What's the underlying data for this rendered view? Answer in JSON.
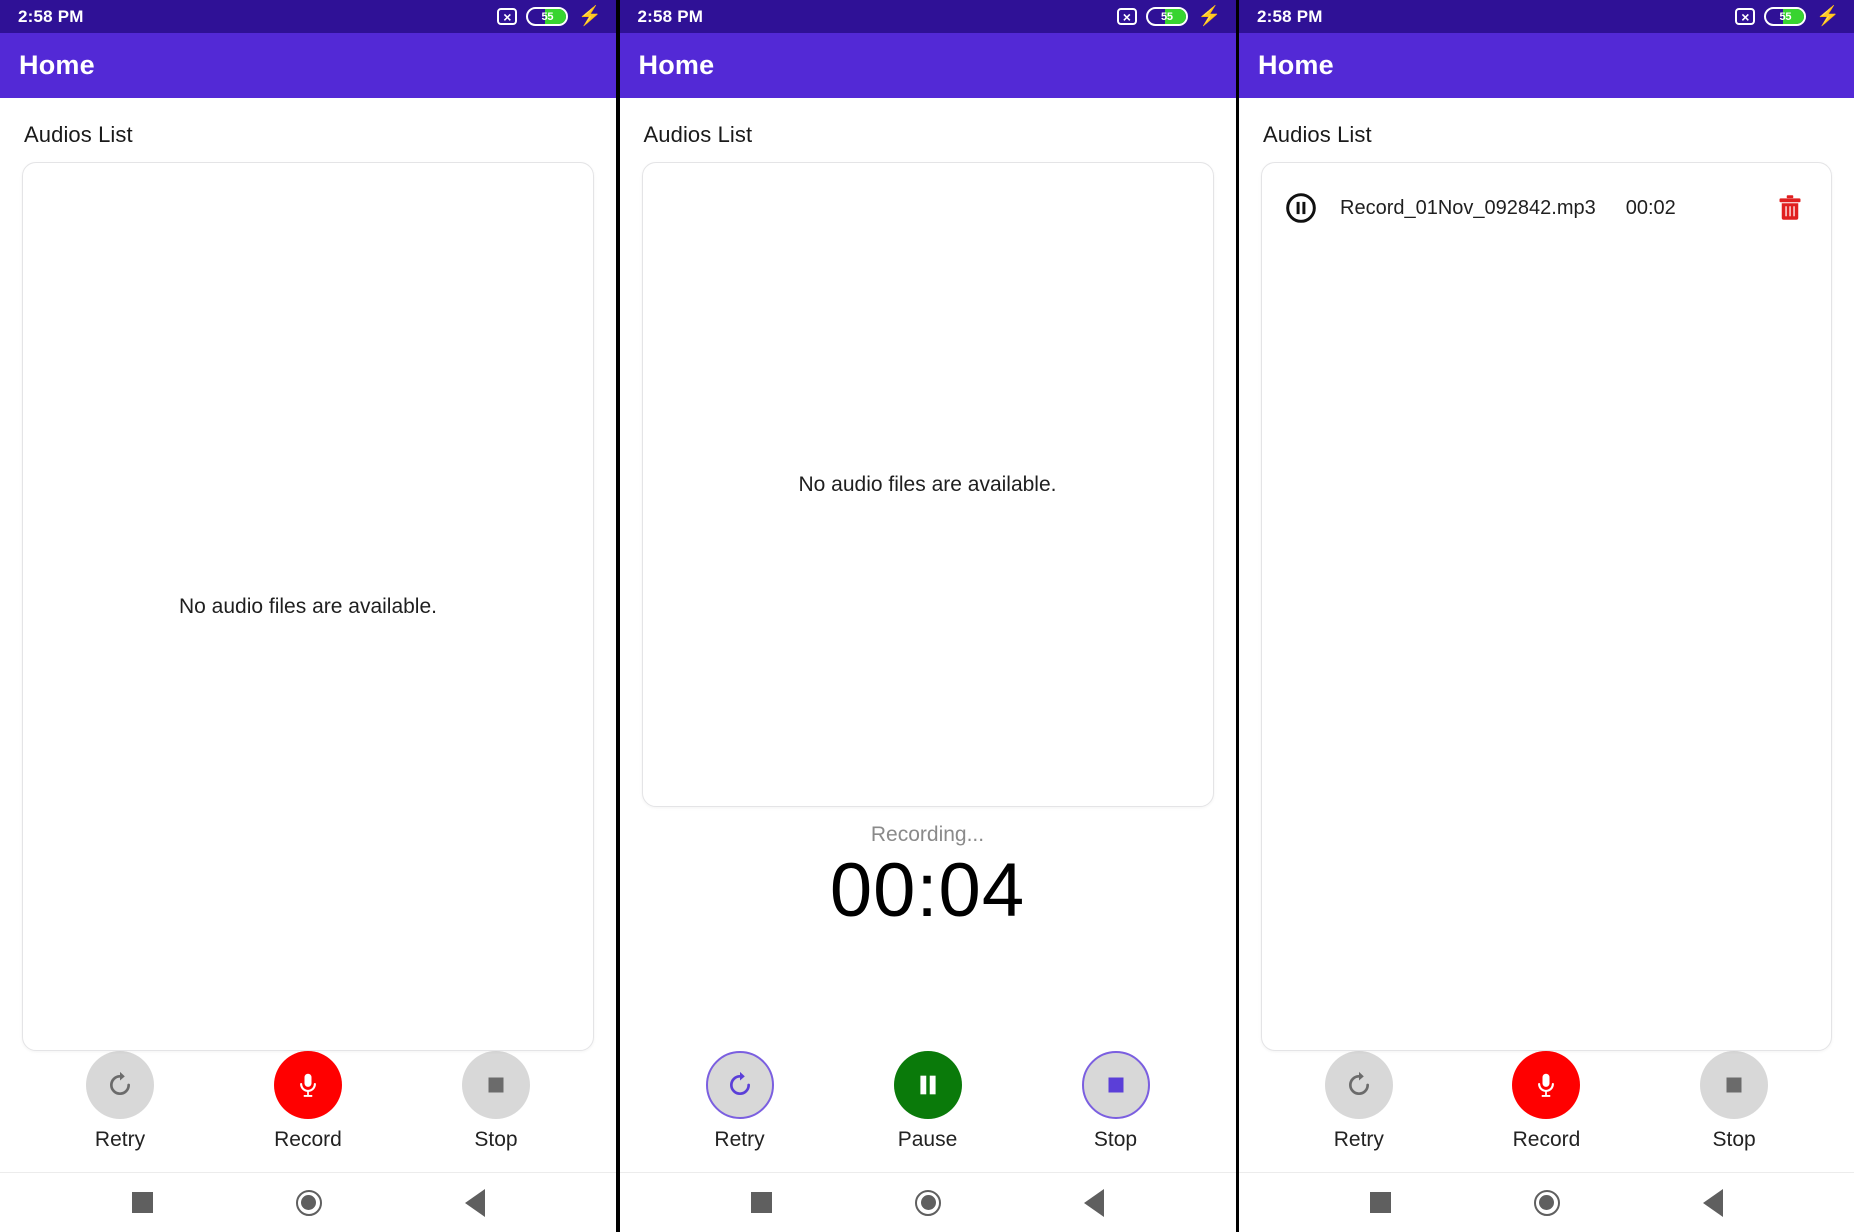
{
  "colors": {
    "status_bar": "#2F1196",
    "app_bar": "#5329D6",
    "accent_purple": "#7B5FE0",
    "record_red": "#FF0000",
    "pause_green": "#0A7A0A",
    "delete_red": "#E53935",
    "idle_gray": "#D8D8D8",
    "battery_green": "#38D430"
  },
  "status_bar": {
    "time": "2:58 PM",
    "sim_icon": "sim-card-disabled-icon",
    "battery_level": "55",
    "charging_icon": "lightning-bolt-icon"
  },
  "app_bar": {
    "title": "Home"
  },
  "section": {
    "title": "Audios List"
  },
  "empty_state": {
    "message": "No audio files are available."
  },
  "nav_bar": {
    "recents": "recents-square-icon",
    "home": "home-circle-icon",
    "back": "back-triangle-icon"
  },
  "panels": [
    {
      "id": "panel-idle",
      "state": "idle",
      "card": {
        "empty": true,
        "empty_message": "No audio files are available."
      },
      "timer": null,
      "controls": [
        {
          "name": "retry",
          "label": "Retry",
          "icon": "refresh-icon",
          "style": "gray",
          "enabled": false
        },
        {
          "name": "record",
          "label": "Record",
          "icon": "microphone-icon",
          "style": "red",
          "enabled": true
        },
        {
          "name": "stop",
          "label": "Stop",
          "icon": "stop-square-icon",
          "style": "gray",
          "enabled": false
        }
      ]
    },
    {
      "id": "panel-recording",
      "state": "recording",
      "card": {
        "empty": true,
        "empty_message": "No audio files are available."
      },
      "timer": {
        "status_label": "Recording...",
        "elapsed": "00:04"
      },
      "controls": [
        {
          "name": "retry",
          "label": "Retry",
          "icon": "refresh-icon",
          "style": "gray-purple-border",
          "enabled": true
        },
        {
          "name": "pause",
          "label": "Pause",
          "icon": "pause-icon",
          "style": "green",
          "enabled": true
        },
        {
          "name": "stop",
          "label": "Stop",
          "icon": "stop-square-icon",
          "style": "gray-purple-border",
          "enabled": true
        }
      ]
    },
    {
      "id": "panel-saved",
      "state": "saved",
      "card": {
        "empty": false,
        "items": [
          {
            "play_icon": "pause-circle-icon",
            "file_name": "Record_01Nov_092842.mp3",
            "duration": "00:02",
            "delete_icon": "trash-icon"
          }
        ]
      },
      "timer": null,
      "controls": [
        {
          "name": "retry",
          "label": "Retry",
          "icon": "refresh-icon",
          "style": "gray",
          "enabled": false
        },
        {
          "name": "record",
          "label": "Record",
          "icon": "microphone-icon",
          "style": "red",
          "enabled": true
        },
        {
          "name": "stop",
          "label": "Stop",
          "icon": "stop-square-icon",
          "style": "gray",
          "enabled": false
        }
      ]
    }
  ]
}
